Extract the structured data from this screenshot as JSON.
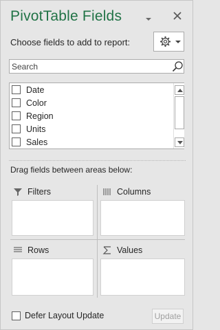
{
  "pane": {
    "title": "PivotTable Fields",
    "choose_label": "Choose fields to add to report:",
    "title_color": "#217346"
  },
  "search": {
    "placeholder": "Search",
    "value": ""
  },
  "fields": [
    {
      "label": "Date",
      "checked": false
    },
    {
      "label": "Color",
      "checked": false
    },
    {
      "label": "Region",
      "checked": false
    },
    {
      "label": "Units",
      "checked": false
    },
    {
      "label": "Sales",
      "checked": false
    }
  ],
  "areas": {
    "drag_label": "Drag fields between areas below:",
    "filters": "Filters",
    "columns": "Columns",
    "rows": "Rows",
    "values": "Values"
  },
  "footer": {
    "defer_label": "Defer Layout Update",
    "defer_checked": false,
    "update_label": "Update"
  },
  "icons": {
    "title_dropdown": "chevron-down-icon",
    "close": "close-icon",
    "settings": "gear-icon",
    "search": "search-icon",
    "filters": "filter-icon",
    "columns": "columns-icon",
    "rows": "rows-icon",
    "values": "sigma-icon"
  }
}
